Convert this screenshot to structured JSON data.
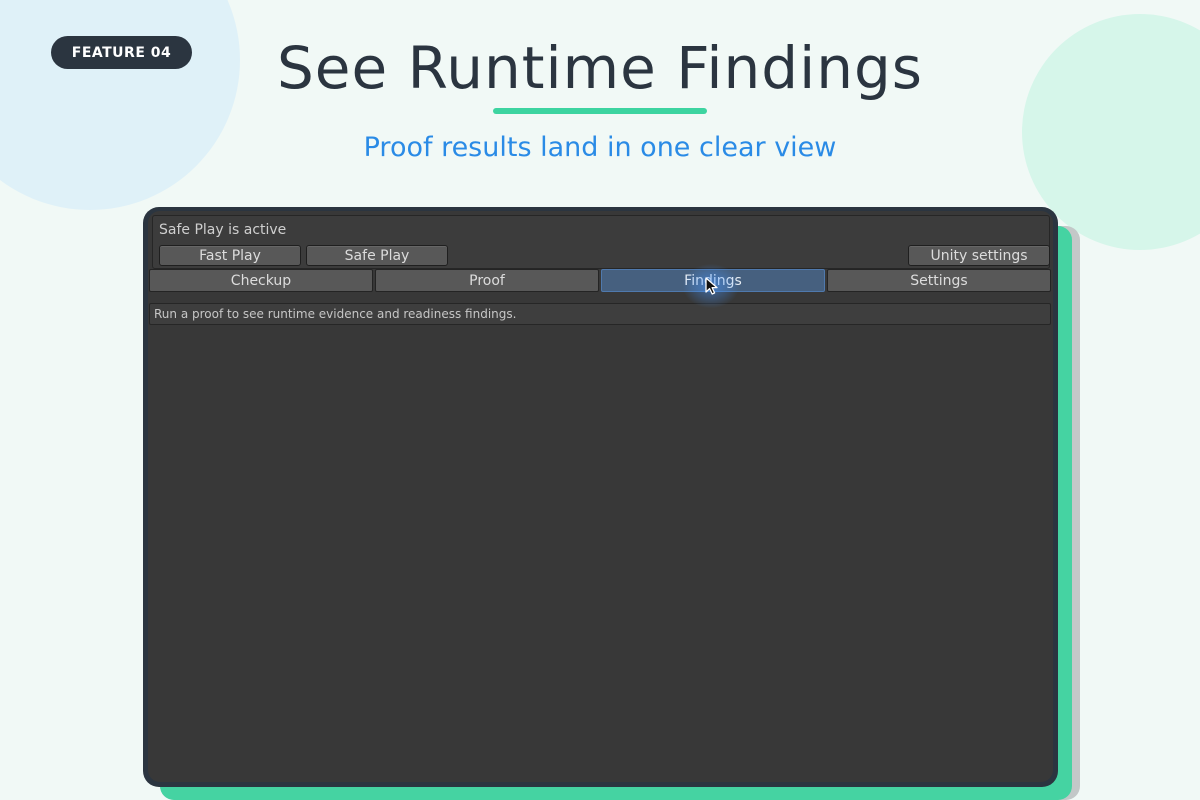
{
  "badge": {
    "label": "FEATURE 04"
  },
  "header": {
    "title": "See Runtime Findings",
    "subtitle": "Proof results land in one clear view"
  },
  "tool": {
    "status_text": "Safe Play is active",
    "buttons": {
      "fast_play": "Fast Play",
      "safe_play": "Safe Play",
      "unity_settings": "Unity settings"
    },
    "tabs": [
      {
        "label": "Checkup",
        "active": false
      },
      {
        "label": "Proof",
        "active": false
      },
      {
        "label": "Findings",
        "active": true
      },
      {
        "label": "Settings",
        "active": false
      }
    ],
    "info_message": "Run a proof to see runtime evidence and readiness findings."
  },
  "colors": {
    "accent_green": "#3dd4a0",
    "subtitle_blue": "#2a8be6",
    "active_tab": "#46607f",
    "panel_bg": "#383838"
  },
  "icons": {
    "cursor": "mouse-pointer-icon"
  }
}
